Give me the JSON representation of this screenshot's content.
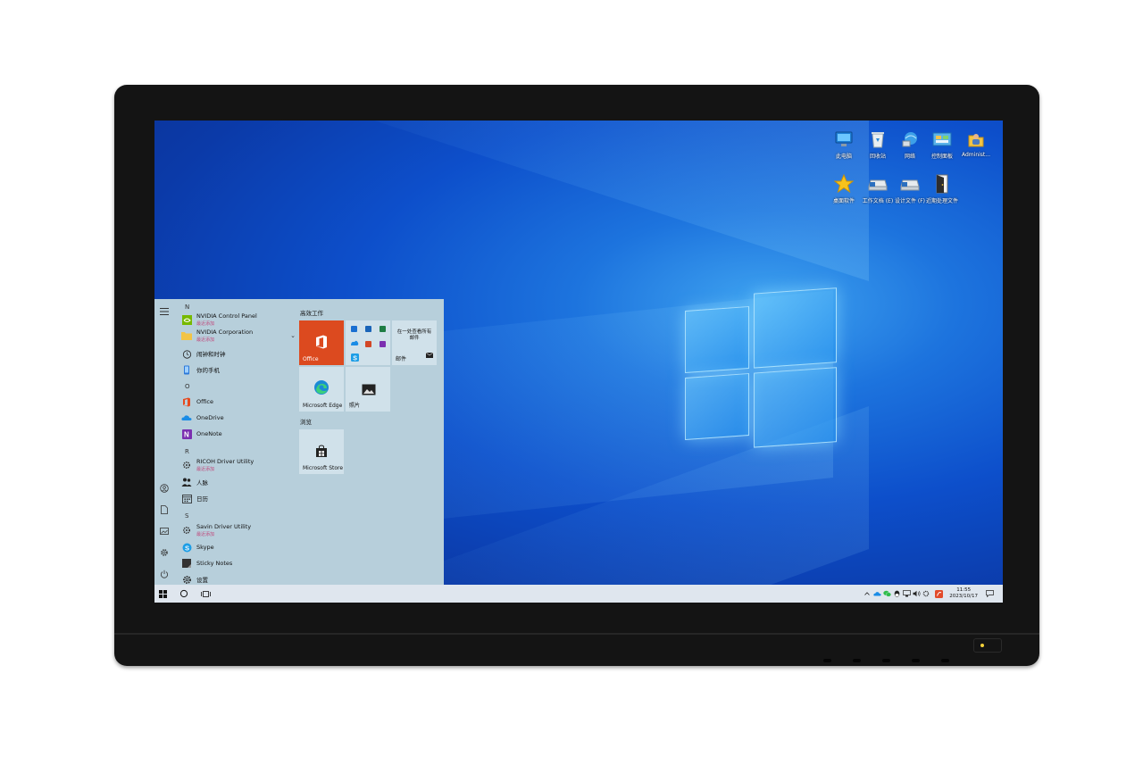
{
  "desktop": {
    "icons": [
      {
        "label": "此电脑",
        "icon": "this-pc-icon"
      },
      {
        "label": "回收站",
        "icon": "recycle-bin-icon"
      },
      {
        "label": "网络",
        "icon": "network-icon"
      },
      {
        "label": "控制面板",
        "icon": "control-panel-icon"
      },
      {
        "label": "Administ...",
        "icon": "user-folder-icon"
      },
      {
        "label": "桌面软件",
        "icon": "star-icon"
      },
      {
        "label": "工作文档 (E)",
        "icon": "drive-icon"
      },
      {
        "label": "设计文件 (F)",
        "icon": "drive-icon"
      },
      {
        "label": "近期处理文件",
        "icon": "door-icon"
      }
    ]
  },
  "start_menu": {
    "letters": [
      "N",
      "O",
      "R",
      "S"
    ],
    "apps": [
      {
        "name": "NVIDIA Control Panel",
        "sub": "最近添加",
        "icon": "nvidia-icon"
      },
      {
        "name": "NVIDIA Corporation",
        "sub": "最近添加",
        "icon": "folder-icon"
      },
      {
        "name": "闹钟和时钟",
        "sub": "",
        "icon": "alarm-clock-icon"
      },
      {
        "name": "你的手机",
        "sub": "",
        "icon": "phone-icon"
      },
      {
        "name": "Office",
        "sub": "",
        "icon": "office-icon"
      },
      {
        "name": "OneDrive",
        "sub": "",
        "icon": "onedrive-icon"
      },
      {
        "name": "OneNote",
        "sub": "",
        "icon": "onenote-icon"
      },
      {
        "name": "RICOH Driver Utility",
        "sub": "最近添加",
        "icon": "gear-app-icon"
      },
      {
        "name": "人脉",
        "sub": "",
        "icon": "people-icon"
      },
      {
        "name": "日历",
        "sub": "",
        "icon": "calendar-icon"
      },
      {
        "name": "Savin Driver Utility",
        "sub": "最近添加",
        "icon": "gear-app-icon"
      },
      {
        "name": "Skype",
        "sub": "",
        "icon": "skype-icon"
      },
      {
        "name": "Sticky Notes",
        "sub": "",
        "icon": "sticky-notes-icon"
      },
      {
        "name": "设置",
        "sub": "",
        "icon": "settings-icon"
      }
    ],
    "groups": {
      "productivity": "高效工作",
      "browse": "浏览"
    },
    "tiles": {
      "office": "Office",
      "mail_heading": "在一处查看所有邮件",
      "mail": "邮件",
      "edge": "Microsoft Edge",
      "photos": "照片",
      "store": "Microsoft Store"
    }
  },
  "taskbar": {
    "time": "11:55",
    "date": "2023/10/17"
  }
}
